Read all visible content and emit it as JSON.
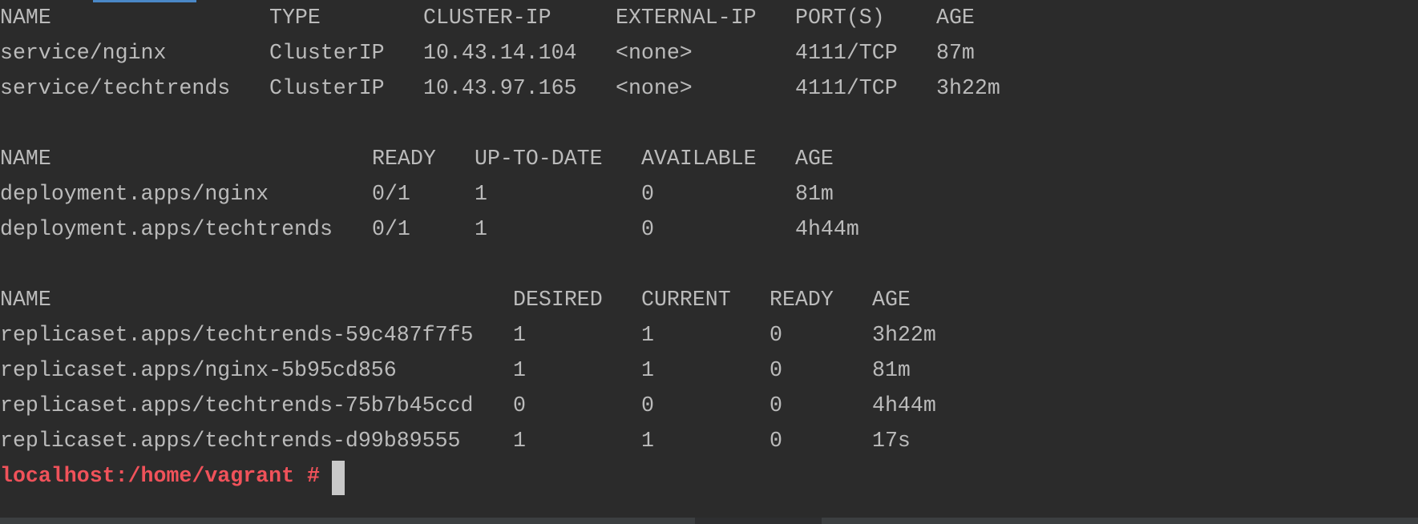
{
  "colors": {
    "background": "#2b2b2b",
    "text": "#bbbbbb",
    "prompt": "#f0525a",
    "tab_indicator": "#4a88c7"
  },
  "services": {
    "headers": [
      "NAME",
      "TYPE",
      "CLUSTER-IP",
      "EXTERNAL-IP",
      "PORT(S)",
      "AGE"
    ],
    "rows": [
      [
        "service/nginx",
        "ClusterIP",
        "10.43.14.104",
        "<none>",
        "4111/TCP",
        "87m"
      ],
      [
        "service/techtrends",
        "ClusterIP",
        "10.43.97.165",
        "<none>",
        "4111/TCP",
        "3h22m"
      ]
    ]
  },
  "deployments": {
    "headers": [
      "NAME",
      "READY",
      "UP-TO-DATE",
      "AVAILABLE",
      "AGE"
    ],
    "rows": [
      [
        "deployment.apps/nginx",
        "0/1",
        "1",
        "0",
        "81m"
      ],
      [
        "deployment.apps/techtrends",
        "0/1",
        "1",
        "0",
        "4h44m"
      ]
    ]
  },
  "replicasets": {
    "headers": [
      "NAME",
      "DESIRED",
      "CURRENT",
      "READY",
      "AGE"
    ],
    "rows": [
      [
        "replicaset.apps/techtrends-59c487f7f5",
        "1",
        "1",
        "0",
        "3h22m"
      ],
      [
        "replicaset.apps/nginx-5b95cd856",
        "1",
        "1",
        "0",
        "81m"
      ],
      [
        "replicaset.apps/techtrends-75b7b45ccd",
        "0",
        "0",
        "0",
        "4h44m"
      ],
      [
        "replicaset.apps/techtrends-d99b89555",
        "1",
        "1",
        "0",
        "17s"
      ]
    ]
  },
  "prompt": "localhost:/home/vagrant #"
}
